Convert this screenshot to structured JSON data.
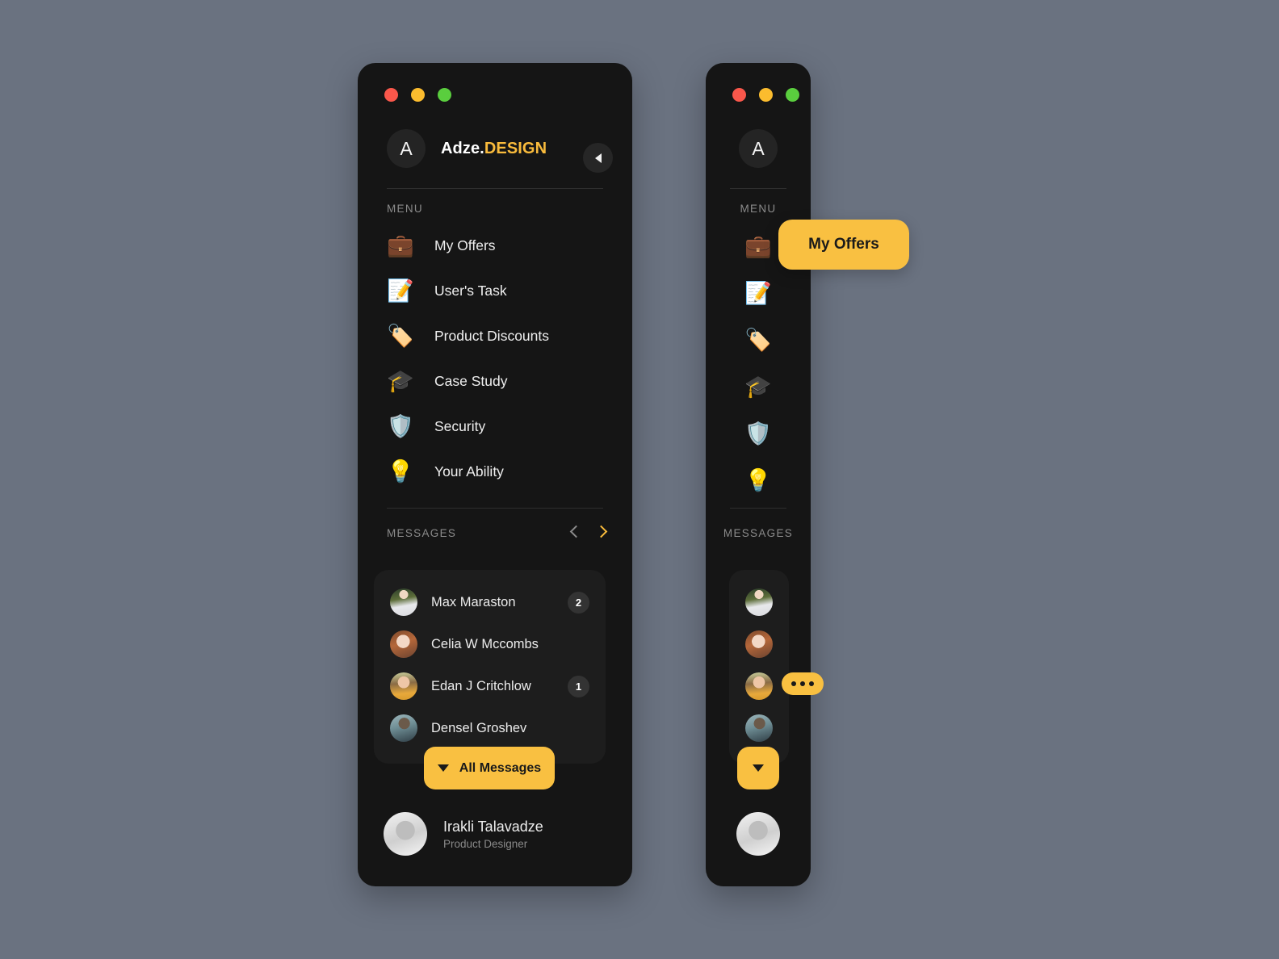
{
  "background_color": "#6a7280",
  "accent_color": "#f9c041",
  "panel_color": "#151515",
  "window_controls": [
    {
      "name": "close",
      "color": "#f9574b"
    },
    {
      "name": "minimize",
      "color": "#fbbc2e"
    },
    {
      "name": "maximize",
      "color": "#5ace3e"
    }
  ],
  "collapse_button": {
    "icon": "triangle-left-icon"
  },
  "brand": {
    "initial": "A",
    "name_primary": "Adze.",
    "name_accent": "DESIGN"
  },
  "menu": {
    "label": "MENU",
    "items": [
      {
        "label": "My Offers",
        "icon": "briefcase-icon",
        "glyph": "💼"
      },
      {
        "label": "User's Task",
        "icon": "clipboard-pencil-icon",
        "glyph": "📝"
      },
      {
        "label": "Product Discounts",
        "icon": "price-tag-percent-icon",
        "glyph": "🏷️"
      },
      {
        "label": "Case Study",
        "icon": "graduation-cap-icon",
        "glyph": "🎓"
      },
      {
        "label": "Security",
        "icon": "shield-check-icon",
        "glyph": "🛡️"
      },
      {
        "label": "Your Ability",
        "icon": "lightbulb-hands-icon",
        "glyph": "💡"
      }
    ]
  },
  "messages": {
    "label": "MESSAGES",
    "prev_icon": "chevron-left-icon",
    "next_icon": "chevron-right-icon",
    "items": [
      {
        "name": "Max Maraston",
        "badge": "2",
        "avatar": "avatar-max"
      },
      {
        "name": "Celia W Mccombs",
        "badge": "",
        "avatar": "avatar-celia"
      },
      {
        "name": "Edan J Critchlow",
        "badge": "1",
        "avatar": "avatar-edan"
      },
      {
        "name": "Densel Groshev",
        "badge": "",
        "avatar": "avatar-densel"
      }
    ],
    "all_button_label": "All Messages",
    "all_button_icon": "caret-down-icon"
  },
  "profile": {
    "name": "Irakli Talavadze",
    "role": "Product Designer",
    "avatar": "avatar-irakli"
  },
  "collapsed": {
    "tooltip_offers": "My Offers",
    "tooltip_dots_icon": "ellipsis-icon",
    "menu_label": "MENU",
    "messages_label": "MESSAGES"
  }
}
